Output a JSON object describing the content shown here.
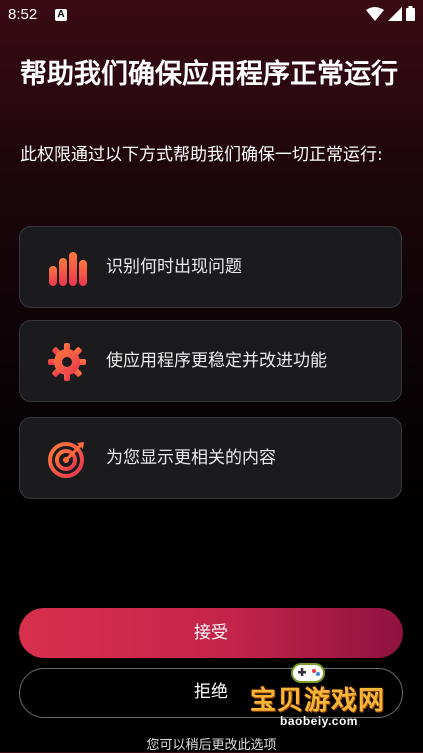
{
  "status_bar": {
    "time": "8:52",
    "notification_icon": "A",
    "icons": [
      "wifi-icon",
      "cell-signal-icon",
      "battery-icon"
    ]
  },
  "title": "帮助我们确保应用程序正常运行",
  "subtitle": "此权限通过以下方式帮助我们确保一切正常运行:",
  "features": [
    {
      "icon": "bar-chart-icon",
      "label": "识别何时出现问题"
    },
    {
      "icon": "gear-icon",
      "label": "使应用程序更稳定并改进功能"
    },
    {
      "icon": "target-icon",
      "label": "为您显示更相关的内容"
    }
  ],
  "buttons": {
    "accept": "接受",
    "reject": "拒绝"
  },
  "footer_note": "您可以稍后更改此选项",
  "watermark": {
    "text": "宝贝游戏网",
    "url": "baobeiy.com"
  },
  "colors": {
    "accent_start": "#d8304c",
    "accent_end": "#8e1240",
    "icon_orange": "#ff6a3d",
    "icon_red": "#e8364f",
    "card_bg": "#1b1b1e"
  }
}
